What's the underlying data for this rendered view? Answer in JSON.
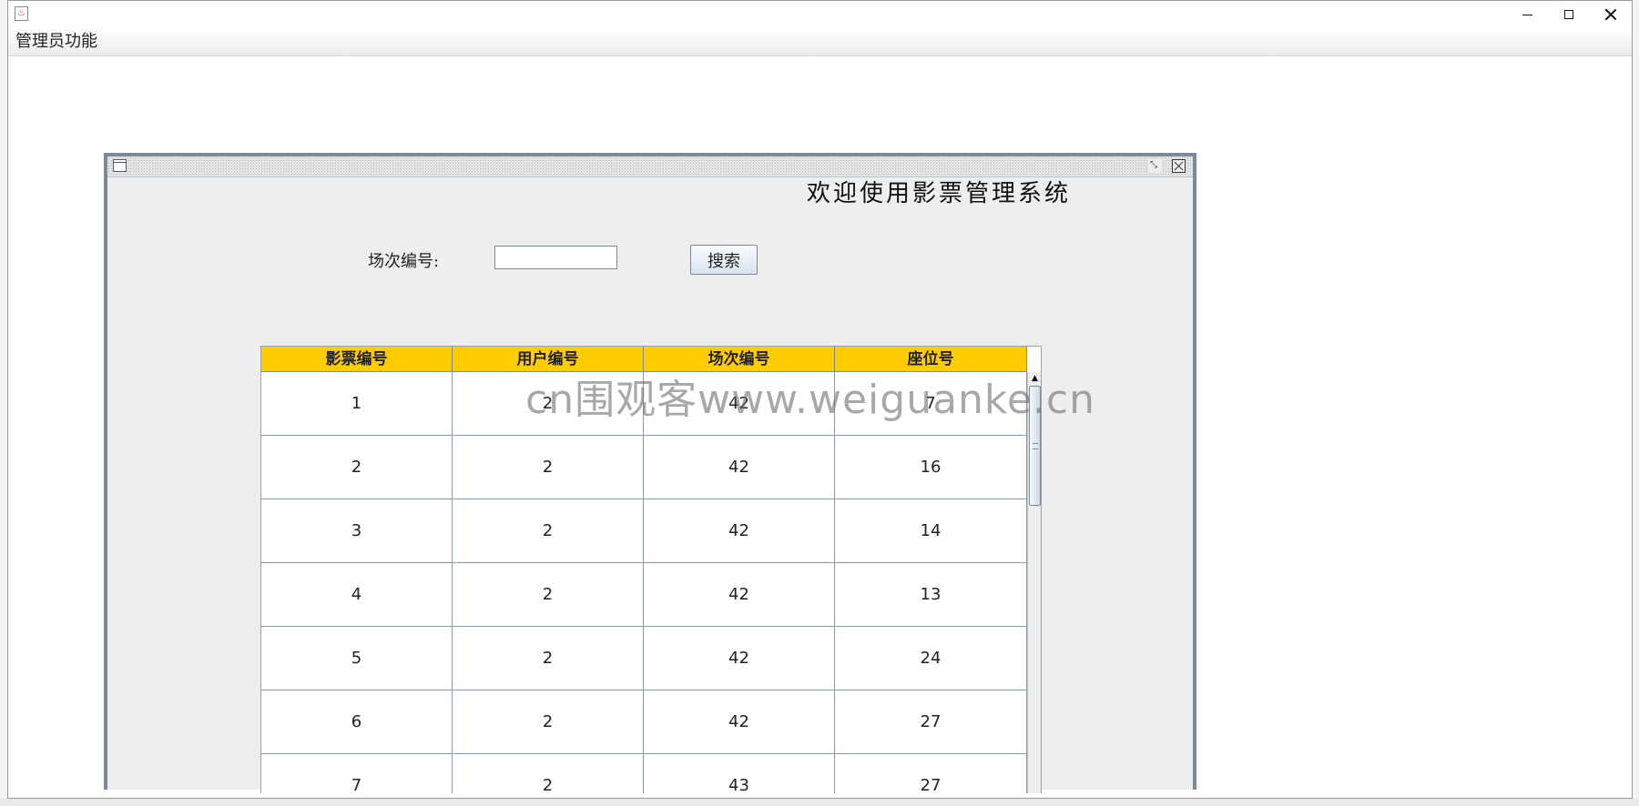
{
  "window": {
    "title": ""
  },
  "menu": {
    "items": [
      {
        "label": "管理员功能"
      }
    ]
  },
  "internal_frame": {
    "title": "",
    "welcome_text": "欢迎使用影票管理系统",
    "search": {
      "label": "场次编号:",
      "value": "",
      "button_label": "搜索"
    },
    "table": {
      "columns": [
        "影票编号",
        "用户编号",
        "场次编号",
        "座位号"
      ],
      "rows": [
        [
          "1",
          "2",
          "42",
          "7"
        ],
        [
          "2",
          "2",
          "42",
          "16"
        ],
        [
          "3",
          "2",
          "42",
          "14"
        ],
        [
          "4",
          "2",
          "42",
          "13"
        ],
        [
          "5",
          "2",
          "42",
          "24"
        ],
        [
          "6",
          "2",
          "42",
          "27"
        ],
        [
          "7",
          "2",
          "43",
          "27"
        ]
      ]
    }
  },
  "watermark": "cn围观客www.weiguanke.cn",
  "colors": {
    "header_bg": "#ffcc00",
    "frame_border": "#7a8a99"
  },
  "icons": [
    "java-app-icon",
    "minimize-icon",
    "maximize-icon",
    "close-icon",
    "frame-icon",
    "frame-restore-icon",
    "frame-close-icon",
    "scroll-up-arrow-icon"
  ]
}
